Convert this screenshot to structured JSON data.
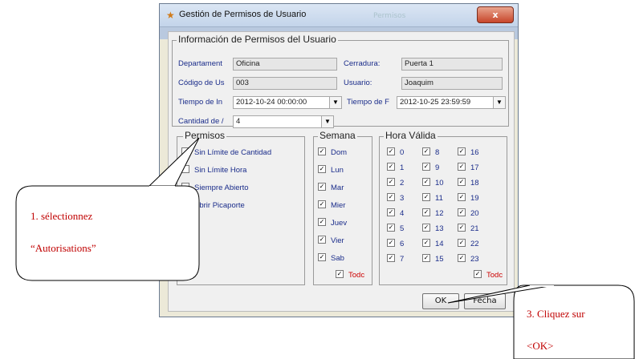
{
  "window": {
    "title": "Gestión de Permisos de Usuario",
    "background_title": "Permisos",
    "close_glyph": "x",
    "icon": "users-key-icon"
  },
  "info_group": {
    "title": "Información de Permisos del Usuario",
    "departamento": {
      "label": "Departament",
      "value": "Oficina"
    },
    "cerradura": {
      "label": "Cerradura:",
      "value": "Puerta 1"
    },
    "codigo": {
      "label": "Código de Us",
      "value": "003"
    },
    "usuario": {
      "label": "Usuario:",
      "value": "Joaquim"
    },
    "tiempo_inicio": {
      "label": "Tiempo de In",
      "value": "2012-10-24 00:00:00"
    },
    "tiempo_fin": {
      "label": "Tiempo de F",
      "value": "2012-10-25 23:59:59"
    },
    "cantidad": {
      "label": "Cantidad de /",
      "value": "4"
    }
  },
  "permisos": {
    "title": "Permisos",
    "items": [
      {
        "label": "Sin Límite de Cantidad",
        "checked": false
      },
      {
        "label": "Sin Límite Hora",
        "checked": false
      },
      {
        "label": "Siempre Abierto",
        "checked": false
      },
      {
        "label": "Abrir Picaporte",
        "checked": false
      }
    ]
  },
  "semana": {
    "title": "Semana",
    "days": [
      {
        "label": "Dom",
        "checked": true
      },
      {
        "label": "Lun",
        "checked": true
      },
      {
        "label": "Mar",
        "checked": true
      },
      {
        "label": "Mier",
        "checked": true
      },
      {
        "label": "Juev",
        "checked": true
      },
      {
        "label": "Vier",
        "checked": true
      },
      {
        "label": "Sab",
        "checked": true
      }
    ],
    "todo_label": "Todc"
  },
  "hora_valida": {
    "title": "Hora Válida",
    "hours": [
      "0",
      "1",
      "2",
      "3",
      "4",
      "5",
      "6",
      "7",
      "8",
      "9",
      "10",
      "11",
      "12",
      "13",
      "14",
      "15",
      "16",
      "17",
      "18",
      "19",
      "20",
      "21",
      "22",
      "23"
    ],
    "all_checked": true,
    "todo_label": "Todc"
  },
  "buttons": {
    "ok": "OK",
    "fecha": "Fecha"
  },
  "callouts": {
    "one": {
      "line1": "1.                sélectionnez",
      "line2": "“Autorisations”"
    },
    "three": {
      "line1": "3.  Cliquez     sur",
      "line2": "<OK>"
    }
  },
  "colors": {
    "label_blue": "#1a2c8a",
    "callout_red": "#c00000",
    "close_red": "#c7452a"
  }
}
